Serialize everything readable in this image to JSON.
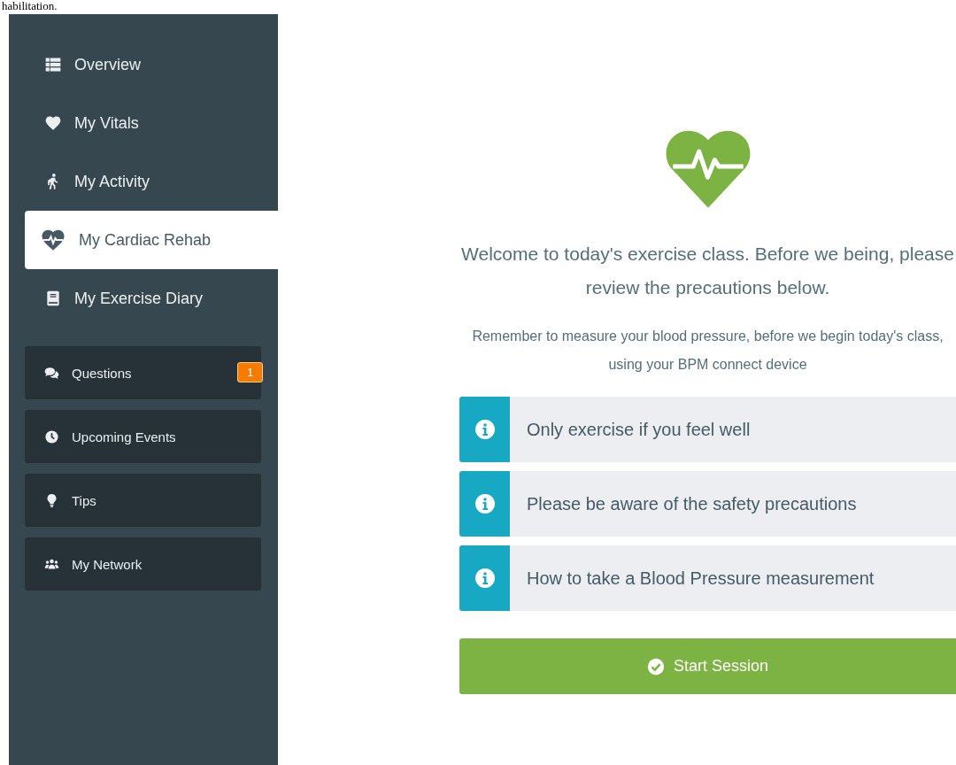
{
  "caption": "habilitation.",
  "sidebar": {
    "nav": [
      {
        "label": "Overview",
        "selected": false
      },
      {
        "label": "My Vitals",
        "selected": false
      },
      {
        "label": "My Activity",
        "selected": false
      },
      {
        "label": "My Cardiac Rehab",
        "selected": true
      },
      {
        "label": "My Exercise Diary",
        "selected": false
      }
    ],
    "cards": [
      {
        "label": "Questions",
        "badge": "1"
      },
      {
        "label": "Upcoming Events"
      },
      {
        "label": "Tips"
      },
      {
        "label": "My Network"
      }
    ]
  },
  "main": {
    "welcome": "Welcome to today's exercise class. Before we being, please review the precautions below.",
    "reminder": "Remember to measure your blood pressure, before we begin today's class, using your BPM connect device",
    "precautions": [
      "Only exercise if you feel well",
      "Please be aware of the safety precautions",
      "How to take a Blood Pressure measurement"
    ],
    "start_button": "Start Session"
  }
}
